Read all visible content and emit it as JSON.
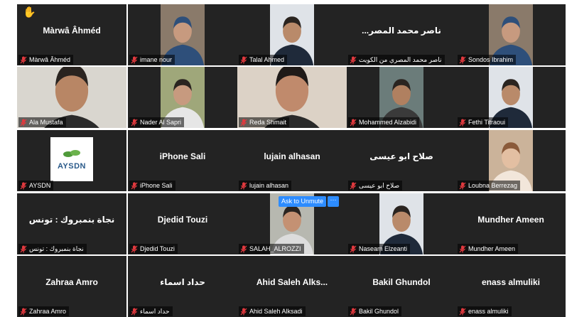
{
  "raised_hand": "✋",
  "ask_to_unmute_label": "Ask to Unmute",
  "more_label": "···",
  "colors": {
    "tile_bg": "#232323",
    "active_border": "#c6d84e",
    "muted_icon": "#e0393e",
    "button_blue": "#2d8cff"
  },
  "tiles": [
    {
      "row": 0,
      "col": 0,
      "label": "Màrwâ Âhméd",
      "center": "Màrwâ Âhméd",
      "photo": false,
      "raised_hand": true
    },
    {
      "row": 0,
      "col": 1,
      "label": "imane nour",
      "center": "",
      "photo": true,
      "photo_kind": "person-hijab"
    },
    {
      "row": 0,
      "col": 2,
      "label": "Talal Ahmed",
      "center": "",
      "photo": true,
      "photo_kind": "person-suit"
    },
    {
      "row": 0,
      "col": 3,
      "label": "ناصر محمد المصري من الكويت",
      "center": "...ناصر محمد المصر",
      "photo": false
    },
    {
      "row": 0,
      "col": 4,
      "label": "Sondos Ibrahim",
      "center": "",
      "photo": true,
      "photo_kind": "person-hijab"
    },
    {
      "row": 1,
      "col": 0,
      "label": "Ala Mustafa",
      "center": "",
      "photo": true,
      "photo_kind": "person-casual"
    },
    {
      "row": 1,
      "col": 1,
      "label": "Nader Al Sapri",
      "center": "",
      "photo": true,
      "photo_kind": "person-outdoor"
    },
    {
      "row": 1,
      "col": 2,
      "label": "Reda Shmait",
      "center": "",
      "photo": true,
      "photo_kind": "person-woman",
      "active": true
    },
    {
      "row": 1,
      "col": 3,
      "label": "Mohammed Alzabidi",
      "center": "",
      "photo": true,
      "photo_kind": "person-cartoon"
    },
    {
      "row": 1,
      "col": 4,
      "label": "Fethi Titraoui",
      "center": "",
      "photo": true,
      "photo_kind": "person-suit"
    },
    {
      "row": 2,
      "col": 0,
      "label": "AYSDN",
      "center": "",
      "photo": true,
      "photo_kind": "logo",
      "logo_text": "AYSDN"
    },
    {
      "row": 2,
      "col": 1,
      "label": "iPhone Sali",
      "center": "iPhone Sali",
      "photo": false
    },
    {
      "row": 2,
      "col": 2,
      "label": "lujain alhasan",
      "center": "lujain alhasan",
      "photo": false
    },
    {
      "row": 2,
      "col": 3,
      "label": "صلاح ابو عيسى",
      "center": "صلاح ابو عيسى",
      "photo": false
    },
    {
      "row": 2,
      "col": 4,
      "label": "Loubna Berrezag",
      "center": "",
      "photo": true,
      "photo_kind": "child"
    },
    {
      "row": 3,
      "col": 0,
      "label": "نجاة بنمبروك : تونس",
      "center": "نجاة بنمبروك : تونس",
      "photo": false
    },
    {
      "row": 3,
      "col": 1,
      "label": "Djedid Touzi",
      "center": "Djedid Touzi",
      "photo": false
    },
    {
      "row": 3,
      "col": 2,
      "label": "SALAH_ALROZZI",
      "center": "",
      "photo": true,
      "photo_kind": "person-scarf"
    },
    {
      "row": 3,
      "col": 3,
      "label": "Naseam Elzeanti",
      "center": "",
      "photo": true,
      "photo_kind": "person-suit"
    },
    {
      "row": 3,
      "col": 4,
      "label": "Mundher Ameen",
      "center": "Mundher Ameen",
      "photo": false
    },
    {
      "row": 4,
      "col": 0,
      "label": "Zahraa Amro",
      "center": "Zahraa Amro",
      "photo": false
    },
    {
      "row": 4,
      "col": 1,
      "label": "حداد اسماء",
      "center": "حداد اسماء",
      "photo": false
    },
    {
      "row": 4,
      "col": 2,
      "label": "Ahid Saleh Alksadi",
      "center": "Ahid Saleh Alks...",
      "photo": false
    },
    {
      "row": 4,
      "col": 3,
      "label": "Bakil Ghundol",
      "center": "Bakil Ghundol",
      "photo": false
    },
    {
      "row": 4,
      "col": 4,
      "label": "enass almuliki",
      "center": "enass almuliki",
      "photo": false
    }
  ]
}
